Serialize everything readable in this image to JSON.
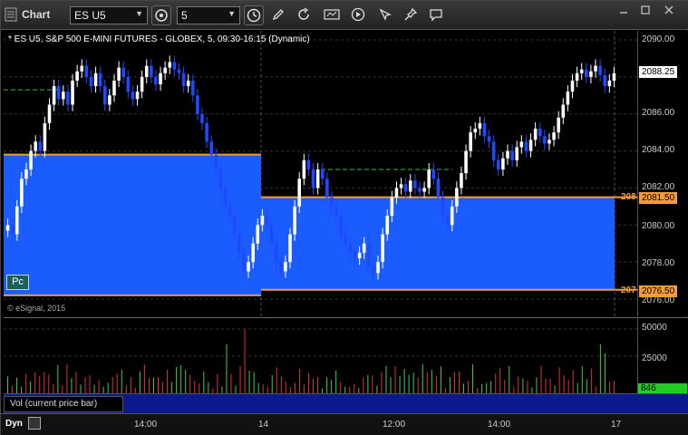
{
  "window": {
    "title": "Chart",
    "symbol": "ES U5",
    "interval": "5"
  },
  "chart": {
    "header": "* ES U5, S&P 500 E-MINI FUTURES - GLOBEX, 5, 09:30-16:15 (Dynamic)",
    "copyright": "© eSignal, 2015",
    "pc_label": "Pc",
    "price_labels": [
      "2090.00",
      "2088.00",
      "2086.00",
      "2084.00",
      "2082.00",
      "2080.00",
      "2078.00",
      "2076.00"
    ],
    "last_price": "2088.25",
    "level_high": "2081.50",
    "level_low": "2076.50",
    "level_high_trunc": "208",
    "level_low_trunc": "207"
  },
  "volume": {
    "axis_labels": [
      "50000",
      "25000"
    ],
    "last_value": "846",
    "legend": "Vol (current price bar)"
  },
  "time_axis": {
    "dyn_label": "Dyn",
    "labels": [
      "14:00",
      "14",
      "12:00",
      "14:00",
      "17"
    ]
  },
  "colors": {
    "zone_fill": "#1a5cff",
    "level_line": "#f39a3a",
    "bar_up": "#ffffff",
    "bar_down": "#1e4aff",
    "last_price_bg": "#ffffff",
    "level_tag_bg": "#f39a3a",
    "vol_last_bg": "#22cc22"
  },
  "icons": [
    "grip-icon",
    "cycle-icon",
    "clock-icon",
    "pencil-icon",
    "refresh-icon",
    "chart-tool-icon",
    "play-icon",
    "cursor-tool-icon",
    "comment-icon"
  ]
}
